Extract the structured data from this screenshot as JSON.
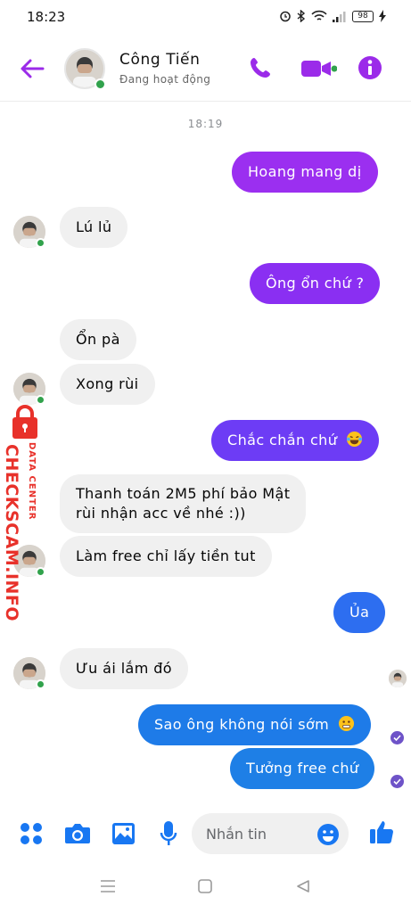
{
  "status_bar": {
    "time": "18:23",
    "battery": "98"
  },
  "header": {
    "contact_name": "Công Tiến",
    "contact_status": "Đang hoạt động"
  },
  "colors": {
    "accent_purple": "#9b2be9",
    "bubble_incoming": "#f0f0f0",
    "online_green": "#31a24c",
    "watermark_red": "#e8312a"
  },
  "chat": {
    "time_separator": "18:19",
    "messages": [
      {
        "from": "me",
        "text": "Hoang mang dị",
        "color": "#9b2ff0"
      },
      {
        "from": "them",
        "text": "Lú lủ"
      },
      {
        "from": "me",
        "text": "Ông ổn chứ ?",
        "color": "#8a2ff2"
      },
      {
        "from": "them",
        "text": "Ổn pà"
      },
      {
        "from": "them",
        "text": "Xong rùi"
      },
      {
        "from": "me",
        "text": "Chắc chắn chứ",
        "emoji": "laughing-tears-emoji",
        "color": "#6d3cf5"
      },
      {
        "from": "them",
        "lines": [
          "Thanh toán 2M5 phí bảo Mật",
          "rùi nhận acc về nhé :))"
        ]
      },
      {
        "from": "them",
        "text": "Làm free chỉ lấy tiền tut"
      },
      {
        "from": "me",
        "text": "Ủa",
        "color": "#2d6ef0"
      },
      {
        "from": "them",
        "text": "Ưu ái lắm đó"
      },
      {
        "from": "me",
        "text": "Sao ông không nói sớm",
        "emoji": "grimacing-emoji",
        "color": "#1e7be8"
      },
      {
        "from": "me",
        "text": "Tưởng free chứ",
        "color": "#1e7fe6"
      }
    ]
  },
  "watermark": {
    "main": "CHECKSCAM.INFO",
    "sub": "DATA CENTER"
  },
  "composer": {
    "placeholder": "Nhắn tin"
  },
  "icons": {
    "back": "arrow-left-icon",
    "call": "phone-icon",
    "video": "video-camera-icon",
    "info": "info-icon",
    "apps": "four-dots-icon",
    "camera": "camera-icon",
    "gallery": "image-icon",
    "mic": "microphone-icon",
    "emoji": "smiley-icon",
    "like": "thumbs-up-icon"
  }
}
